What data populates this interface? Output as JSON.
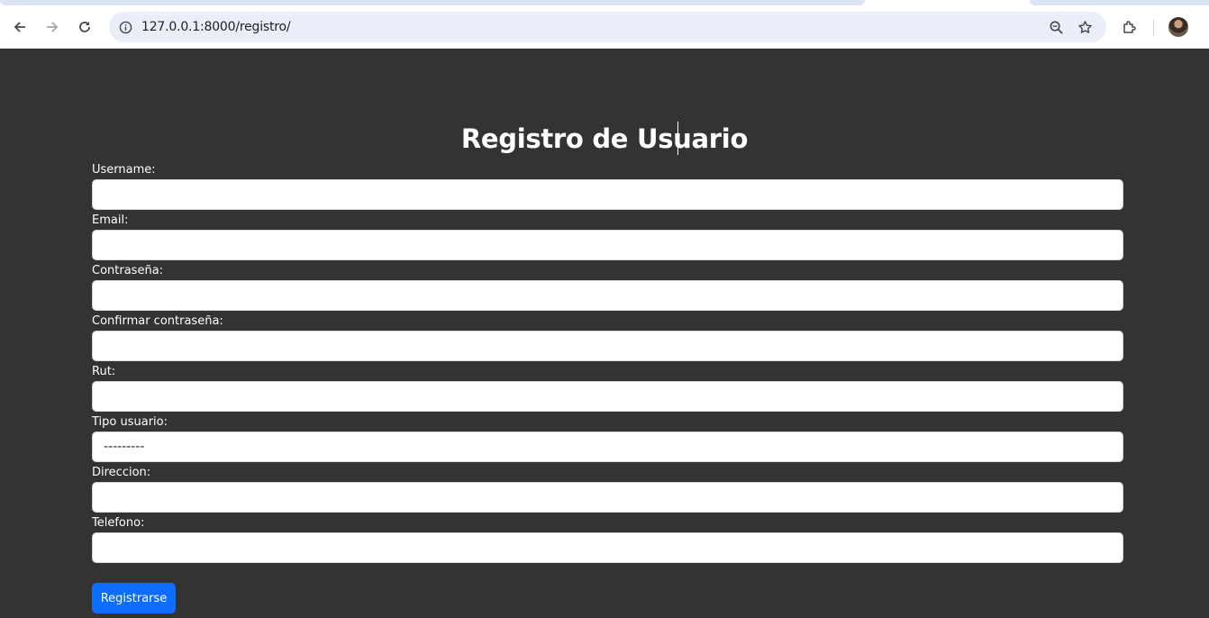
{
  "browser": {
    "url": "127.0.0.1:8000/registro/"
  },
  "page": {
    "title": "Registro de Usuario"
  },
  "form": {
    "fields": [
      {
        "label": "Username:",
        "value": ""
      },
      {
        "label": "Email:",
        "value": ""
      },
      {
        "label": "Contraseña:",
        "value": ""
      },
      {
        "label": "Confirmar contraseña:",
        "value": ""
      },
      {
        "label": "Rut:",
        "value": ""
      },
      {
        "label": "Tipo usuario:",
        "selected": "---------"
      },
      {
        "label": "Direccion:",
        "value": ""
      },
      {
        "label": "Telefono:",
        "value": ""
      }
    ],
    "submit_label": "Registrarse"
  },
  "colors": {
    "page_bg": "#333333",
    "accent": "#0d6efd"
  }
}
